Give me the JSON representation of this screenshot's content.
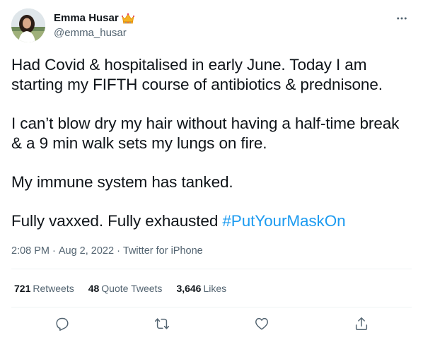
{
  "author": {
    "display_name": "Emma Husar",
    "handle": "@emma_husar",
    "name_emoji": "crown-emoji"
  },
  "tweet": {
    "paragraphs": [
      "Had Covid & hospitalised in early June. Today I am starting my FIFTH course of antibiotics & prednisone.",
      "I can’t blow dry my hair without having a half-time break & a 9 min walk sets my lungs on fire.",
      "My immune system has tanked."
    ],
    "last_paragraph_text": "Fully vaxxed. Fully exhausted ",
    "hashtag": "#PutYourMaskOn"
  },
  "meta": {
    "time": "2:08 PM",
    "separator": "·",
    "date": "Aug 2, 2022",
    "source": "Twitter for iPhone"
  },
  "stats": {
    "retweets_count": "721",
    "retweets_label": "Retweets",
    "quotes_count": "48",
    "quotes_label": "Quote Tweets",
    "likes_count": "3,646",
    "likes_label": "Likes"
  },
  "actions": [
    "reply-icon",
    "retweet-icon",
    "like-icon",
    "share-icon"
  ],
  "colors": {
    "text": "#0f1419",
    "secondary": "#536471",
    "link": "#1d9bf0",
    "divider": "#eff3f4",
    "crown": "#f5a623"
  }
}
